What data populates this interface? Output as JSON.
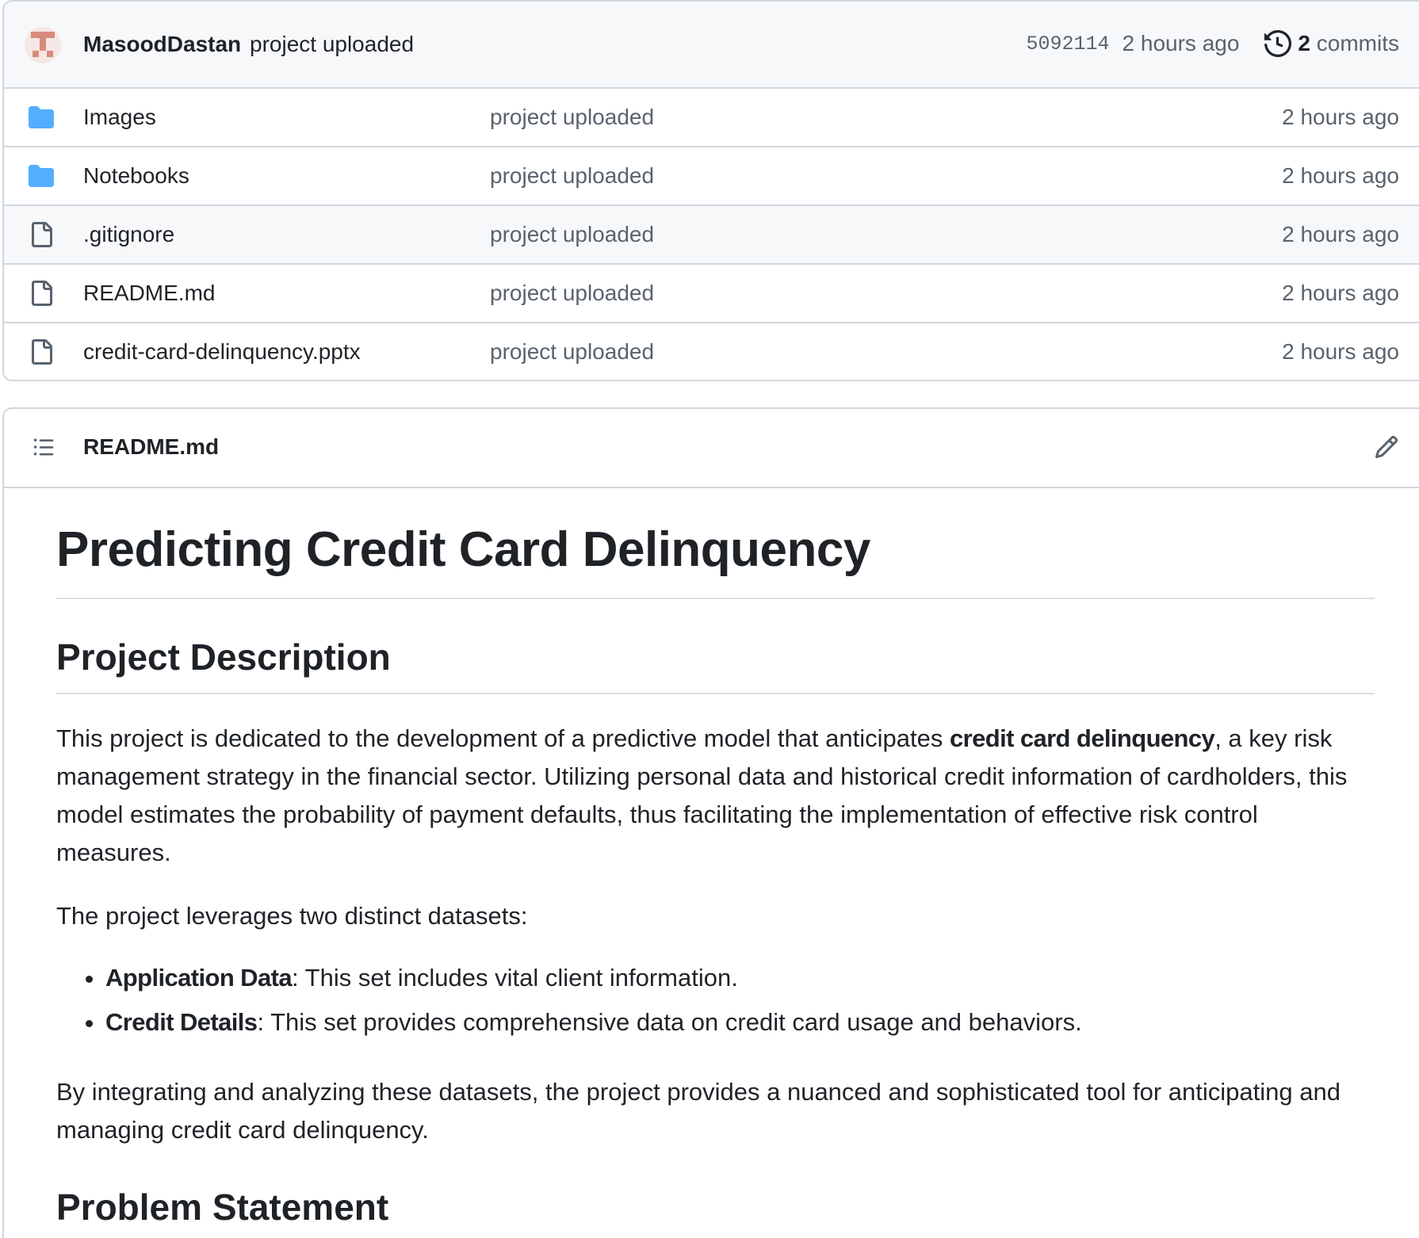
{
  "last_commit": {
    "author": "MasoodDastan",
    "message": "project uploaded",
    "sha": "5092114",
    "time": "2 hours ago",
    "commit_count": "2",
    "commit_label": "commits"
  },
  "files": [
    {
      "type": "folder",
      "name": "Images",
      "message": "project uploaded",
      "time": "2 hours ago",
      "icon": "folder-icon"
    },
    {
      "type": "folder",
      "name": "Notebooks",
      "message": "project uploaded",
      "time": "2 hours ago",
      "icon": "folder-icon"
    },
    {
      "type": "file",
      "name": ".gitignore",
      "message": "project uploaded",
      "time": "2 hours ago",
      "icon": "file-icon"
    },
    {
      "type": "file",
      "name": "README.md",
      "message": "project uploaded",
      "time": "2 hours ago",
      "icon": "file-icon"
    },
    {
      "type": "file",
      "name": "credit-card-delinquency.pptx",
      "message": "project uploaded",
      "time": "2 hours ago",
      "icon": "file-icon"
    }
  ],
  "readme": {
    "filename": "README.md",
    "title": "Predicting Credit Card Delinquency",
    "section1_heading": "Project Description",
    "para1_before": "This project is dedicated to the development of a predictive model that anticipates ",
    "para1_bold": "credit card delinquency",
    "para1_after": ", a key risk management strategy in the financial sector. Utilizing personal data and historical credit information of cardholders, this model estimates the probability of payment defaults, thus facilitating the implementation of effective risk control measures.",
    "para2": "The project leverages two distinct datasets:",
    "bullets": [
      {
        "bold": "Application Data",
        "text": ": This set includes vital client information."
      },
      {
        "bold": "Credit Details",
        "text": ": This set provides comprehensive data on credit card usage and behaviors."
      }
    ],
    "para3": "By integrating and analyzing these datasets, the project provides a nuanced and sophisticated tool for anticipating and managing credit card delinquency.",
    "section2_heading": "Problem Statement"
  },
  "colors": {
    "folder": "#54aeff",
    "border": "#d0d7de",
    "muted_text": "#59636e",
    "text": "#1f2328",
    "header_bg": "#f6f8fa"
  }
}
